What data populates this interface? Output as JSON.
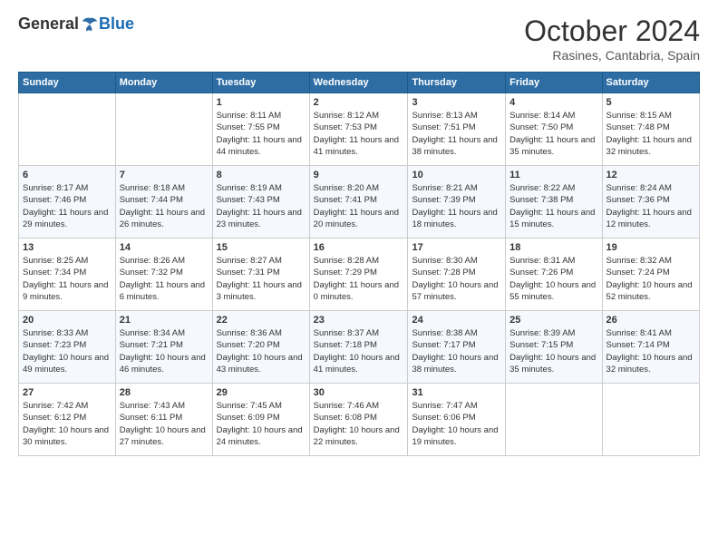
{
  "logo": {
    "general": "General",
    "blue": "Blue"
  },
  "title": "October 2024",
  "subtitle": "Rasines, Cantabria, Spain",
  "days_header": [
    "Sunday",
    "Monday",
    "Tuesday",
    "Wednesday",
    "Thursday",
    "Friday",
    "Saturday"
  ],
  "weeks": [
    [
      {
        "date": "",
        "info": ""
      },
      {
        "date": "",
        "info": ""
      },
      {
        "date": "1",
        "info": "Sunrise: 8:11 AM\nSunset: 7:55 PM\nDaylight: 11 hours and 44 minutes."
      },
      {
        "date": "2",
        "info": "Sunrise: 8:12 AM\nSunset: 7:53 PM\nDaylight: 11 hours and 41 minutes."
      },
      {
        "date": "3",
        "info": "Sunrise: 8:13 AM\nSunset: 7:51 PM\nDaylight: 11 hours and 38 minutes."
      },
      {
        "date": "4",
        "info": "Sunrise: 8:14 AM\nSunset: 7:50 PM\nDaylight: 11 hours and 35 minutes."
      },
      {
        "date": "5",
        "info": "Sunrise: 8:15 AM\nSunset: 7:48 PM\nDaylight: 11 hours and 32 minutes."
      }
    ],
    [
      {
        "date": "6",
        "info": "Sunrise: 8:17 AM\nSunset: 7:46 PM\nDaylight: 11 hours and 29 minutes."
      },
      {
        "date": "7",
        "info": "Sunrise: 8:18 AM\nSunset: 7:44 PM\nDaylight: 11 hours and 26 minutes."
      },
      {
        "date": "8",
        "info": "Sunrise: 8:19 AM\nSunset: 7:43 PM\nDaylight: 11 hours and 23 minutes."
      },
      {
        "date": "9",
        "info": "Sunrise: 8:20 AM\nSunset: 7:41 PM\nDaylight: 11 hours and 20 minutes."
      },
      {
        "date": "10",
        "info": "Sunrise: 8:21 AM\nSunset: 7:39 PM\nDaylight: 11 hours and 18 minutes."
      },
      {
        "date": "11",
        "info": "Sunrise: 8:22 AM\nSunset: 7:38 PM\nDaylight: 11 hours and 15 minutes."
      },
      {
        "date": "12",
        "info": "Sunrise: 8:24 AM\nSunset: 7:36 PM\nDaylight: 11 hours and 12 minutes."
      }
    ],
    [
      {
        "date": "13",
        "info": "Sunrise: 8:25 AM\nSunset: 7:34 PM\nDaylight: 11 hours and 9 minutes."
      },
      {
        "date": "14",
        "info": "Sunrise: 8:26 AM\nSunset: 7:32 PM\nDaylight: 11 hours and 6 minutes."
      },
      {
        "date": "15",
        "info": "Sunrise: 8:27 AM\nSunset: 7:31 PM\nDaylight: 11 hours and 3 minutes."
      },
      {
        "date": "16",
        "info": "Sunrise: 8:28 AM\nSunset: 7:29 PM\nDaylight: 11 hours and 0 minutes."
      },
      {
        "date": "17",
        "info": "Sunrise: 8:30 AM\nSunset: 7:28 PM\nDaylight: 10 hours and 57 minutes."
      },
      {
        "date": "18",
        "info": "Sunrise: 8:31 AM\nSunset: 7:26 PM\nDaylight: 10 hours and 55 minutes."
      },
      {
        "date": "19",
        "info": "Sunrise: 8:32 AM\nSunset: 7:24 PM\nDaylight: 10 hours and 52 minutes."
      }
    ],
    [
      {
        "date": "20",
        "info": "Sunrise: 8:33 AM\nSunset: 7:23 PM\nDaylight: 10 hours and 49 minutes."
      },
      {
        "date": "21",
        "info": "Sunrise: 8:34 AM\nSunset: 7:21 PM\nDaylight: 10 hours and 46 minutes."
      },
      {
        "date": "22",
        "info": "Sunrise: 8:36 AM\nSunset: 7:20 PM\nDaylight: 10 hours and 43 minutes."
      },
      {
        "date": "23",
        "info": "Sunrise: 8:37 AM\nSunset: 7:18 PM\nDaylight: 10 hours and 41 minutes."
      },
      {
        "date": "24",
        "info": "Sunrise: 8:38 AM\nSunset: 7:17 PM\nDaylight: 10 hours and 38 minutes."
      },
      {
        "date": "25",
        "info": "Sunrise: 8:39 AM\nSunset: 7:15 PM\nDaylight: 10 hours and 35 minutes."
      },
      {
        "date": "26",
        "info": "Sunrise: 8:41 AM\nSunset: 7:14 PM\nDaylight: 10 hours and 32 minutes."
      }
    ],
    [
      {
        "date": "27",
        "info": "Sunrise: 7:42 AM\nSunset: 6:12 PM\nDaylight: 10 hours and 30 minutes."
      },
      {
        "date": "28",
        "info": "Sunrise: 7:43 AM\nSunset: 6:11 PM\nDaylight: 10 hours and 27 minutes."
      },
      {
        "date": "29",
        "info": "Sunrise: 7:45 AM\nSunset: 6:09 PM\nDaylight: 10 hours and 24 minutes."
      },
      {
        "date": "30",
        "info": "Sunrise: 7:46 AM\nSunset: 6:08 PM\nDaylight: 10 hours and 22 minutes."
      },
      {
        "date": "31",
        "info": "Sunrise: 7:47 AM\nSunset: 6:06 PM\nDaylight: 10 hours and 19 minutes."
      },
      {
        "date": "",
        "info": ""
      },
      {
        "date": "",
        "info": ""
      }
    ]
  ]
}
